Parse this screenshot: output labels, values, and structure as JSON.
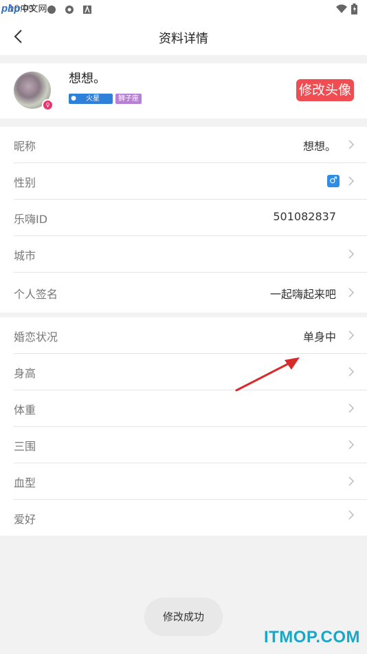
{
  "watermarks": {
    "top_left_latin": "php",
    "top_left_cn": "中文网",
    "bottom_right": "ITMOP.COM"
  },
  "status": {
    "time": "10:09"
  },
  "header": {
    "title": "资料详情"
  },
  "profile": {
    "nickname": "想想。",
    "location_tag": "火星",
    "zodiac_tag": "狮子座",
    "edit_avatar_label": "修改头像"
  },
  "basic_info": [
    {
      "label": "昵称",
      "value": "想想。"
    },
    {
      "label": "性别",
      "value": "♂"
    },
    {
      "label": "乐嗨ID",
      "value": "501082837"
    },
    {
      "label": "城市",
      "value": ""
    },
    {
      "label": "个人签名",
      "value": "一起嗨起来吧"
    }
  ],
  "extra_info": [
    {
      "label": "婚恋状况",
      "value": "单身中"
    },
    {
      "label": "身高",
      "value": ""
    },
    {
      "label": "体重",
      "value": ""
    },
    {
      "label": "三围",
      "value": ""
    },
    {
      "label": "血型",
      "value": ""
    },
    {
      "label": "爱好",
      "value": ""
    }
  ],
  "toast": "修改成功",
  "colors": {
    "accent_red": "#ef4d52",
    "location_blue": "#2f80d8",
    "zodiac_purple": "#b77fd6",
    "gender_blue": "#2f8de4",
    "watermark_cyan": "#18a7c9"
  }
}
